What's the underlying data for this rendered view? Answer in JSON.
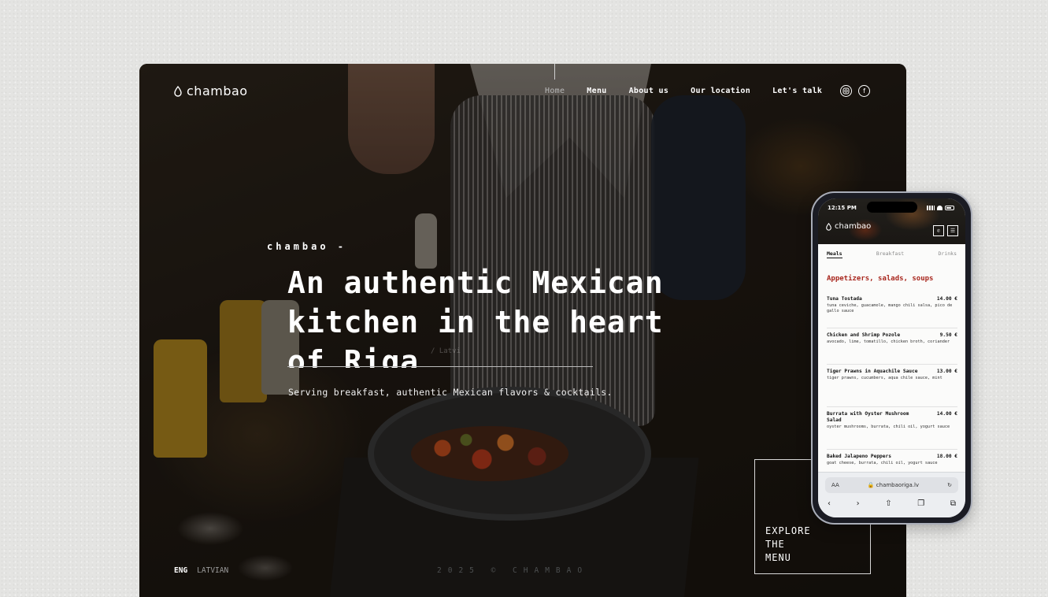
{
  "desktop": {
    "logo": "chambao",
    "nav": [
      "Home",
      "Menu",
      "About us",
      "Our location",
      "Let's talk"
    ],
    "social": [
      "instagram-icon",
      "facebook-icon"
    ],
    "eyebrow": "chambao -",
    "headline": {
      "line1_regular": "An authentic ",
      "line1_bold": "Mexican",
      "line2_bold": "kitchen",
      "line2_regular": " in the heart",
      "line3_regular": "of Riga"
    },
    "ghost_text": "/ Latvi",
    "subtitle": "Serving breakfast, authentic Mexican flavors & cocktails.",
    "lang_active": "ENG",
    "lang_other": "LATVIAN",
    "copyright": "2025 © CHAMBAO",
    "explore": [
      "EXPLORE",
      "THE",
      "MENU"
    ]
  },
  "phone": {
    "time": "12:15 PM",
    "logo": "chambao",
    "tabs": [
      "Meals",
      "Breakfast",
      "Drinks"
    ],
    "section_title": "Appetizers, salads, soups",
    "items": [
      {
        "name": "Tuna Tostada",
        "price": "14.00 €",
        "desc": "tuna ceviche, guacamole, mango chili salsa, pico de gallo sauce"
      },
      {
        "name": "Chicken and Shrimp Pozole",
        "price": "9.50 €",
        "desc": "avocado, lime, tomatillo, chicken broth, coriander"
      },
      {
        "name": "Tiger Prawns in Aquachile Sauce",
        "price": "13.00 €",
        "desc": "tiger prawns, cucumbers, aqua chile sauce, mint"
      },
      {
        "name": "Burrata with Oyster Mushroom Salad",
        "price": "14.00 €",
        "desc": "oyster mushrooms, burrata, chili oil, yogurt sauce"
      },
      {
        "name": "Baked Jalapeno Peppers",
        "price": "18.00 €",
        "desc": "goat cheese, burrata, chili oil, yogurt sauce"
      }
    ],
    "safari": {
      "aa": "AA",
      "url": "chambaoriga.lv"
    }
  }
}
